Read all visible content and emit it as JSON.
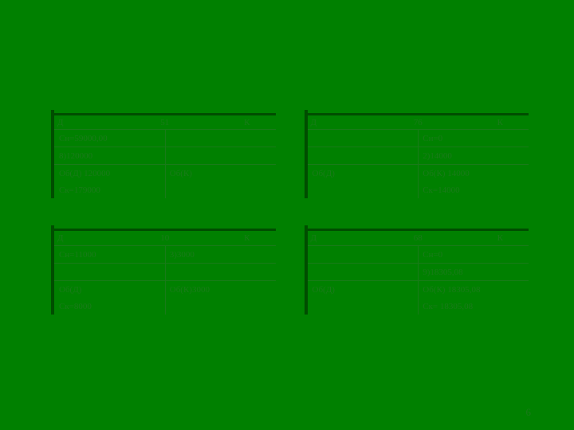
{
  "page_number": "6",
  "labels": {
    "debit": "Д",
    "credit": "К"
  },
  "accounts": [
    {
      "number": "51",
      "sn_left": "Сн=59000,00",
      "sn_right": "",
      "entry_left": "8)120000",
      "entry_right": "",
      "ob_left": "Об(Д) 120000",
      "ob_right": "Об(К)",
      "sk_left": "Ск=179000",
      "sk_right": "",
      "blank_before_entry": false
    },
    {
      "number": "76",
      "sn_left": "",
      "sn_right": "Сн=0",
      "entry_left": "",
      "entry_right": "2)14000",
      "ob_left": "Об(Д)",
      "ob_right": "Об(К) 14000",
      "sk_left": "",
      "sk_right": "Ск=14000",
      "blank_before_entry": false
    },
    {
      "number": "10",
      "sn_left": "Сн=11000",
      "sn_right": "3)3000",
      "entry_left": "",
      "entry_right": "",
      "ob_left": "Об(Д)",
      "ob_right": "Об(К)3000",
      "sk_left": "Ск=8000",
      "sk_right": "",
      "blank_before_entry": true
    },
    {
      "number": "68",
      "sn_left": "",
      "sn_right": "Сн=0",
      "entry_left": "",
      "entry_right": "9)18305,08",
      "ob_left": "Об(Д)",
      "ob_right": "Об(К) 18305,08",
      "sk_left": "",
      "sk_right": "Ск= 18305,08",
      "blank_before_entry": false
    }
  ]
}
